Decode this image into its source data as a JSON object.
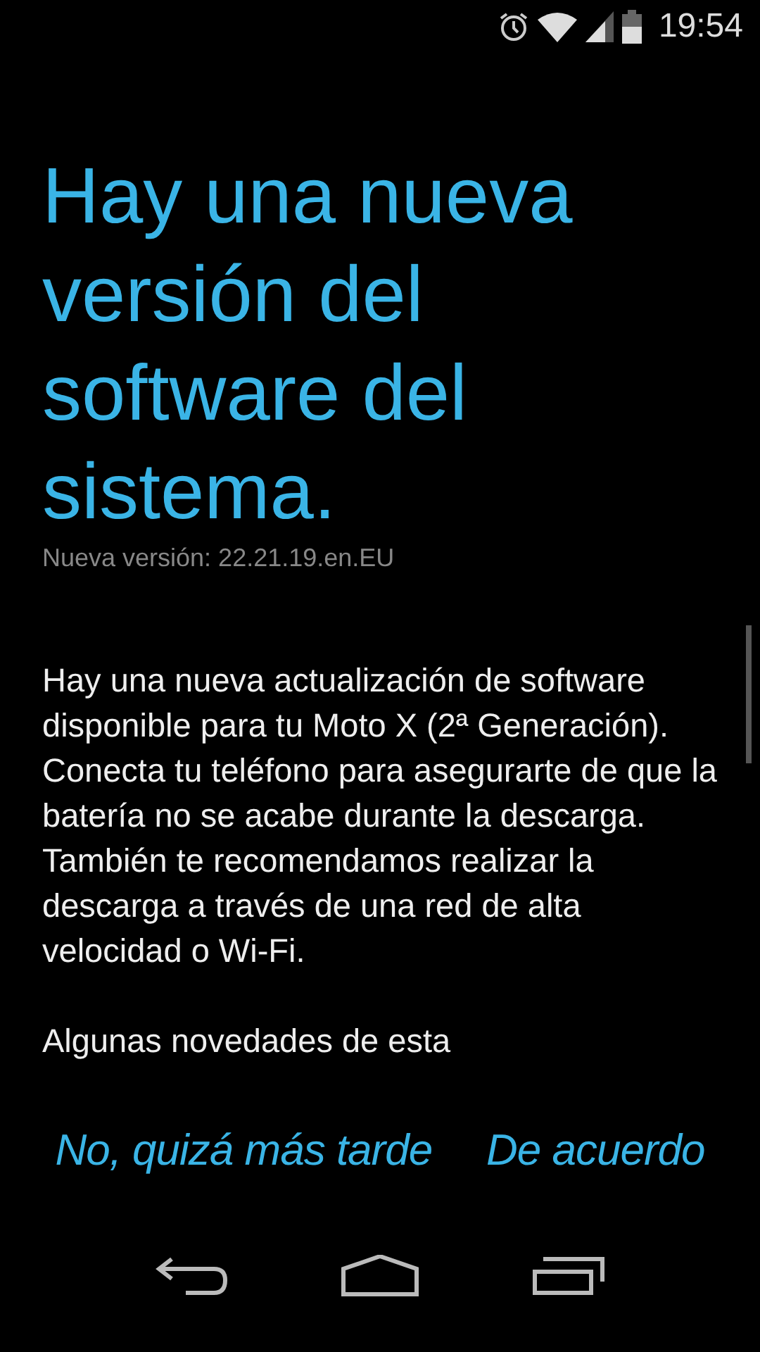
{
  "status_bar": {
    "time": "19:54"
  },
  "title": "Hay una nueva versión del software del sistema.",
  "version": "Nueva versión: 22.21.19.en.EU",
  "paragraphs": [
    "Hay una nueva actualización de software disponible para tu Moto X (2ª Generación). Conecta tu teléfono para asegurarte de que la batería no se acabe durante la descarga. También te recomendamos realizar la descarga a través de una red de alta velocidad o Wi-Fi.",
    "Algunas novedades de esta"
  ],
  "buttons": [
    "No, quizá más tarde",
    "De acuerdo"
  ]
}
